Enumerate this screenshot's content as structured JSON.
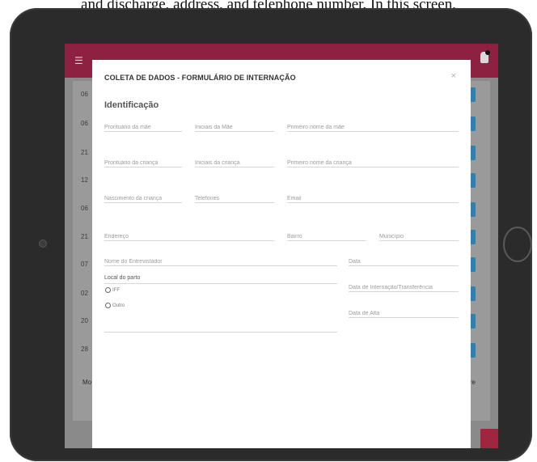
{
  "caption": {
    "text": "and discharge, address, and telephone number. In this screen,"
  },
  "app": {
    "bg_rows": [
      "06",
      "06",
      "21",
      "12",
      "06",
      "21",
      "07",
      "02",
      "20",
      "28"
    ],
    "bg_more_left": "Mo",
    "bg_more_right": "ire"
  },
  "modal": {
    "title": "COLETA DE DADOS - FORMULÁRIO DE INTERNAÇÃO",
    "section": "Identificação",
    "fields": {
      "prontuario_mae": "Prontuário da mãe",
      "iniciais_mae": "Iniciais da Mãe",
      "primeiro_nome_mae": "Primeiro nome da mãe",
      "prontuario_crianca": "Prontuário da criança",
      "iniciais_crianca": "Iniciais da criança",
      "primeiro_nome_crianca": "Primeiro nome da criança",
      "nascimento_crianca": "Nascimento da criança",
      "telefones": "Telefones",
      "email": "Email",
      "endereco": "Endereço",
      "bairro": "Bairro",
      "municipio": "Município",
      "entrevistador": "Nome do Entrevistador",
      "data": "Data",
      "data_internacao": "Data de Internação/Transferência",
      "data_alta": "Data de Alta"
    },
    "local_parto": {
      "label": "Local do parto",
      "options": [
        "IFF",
        "Outro"
      ]
    }
  }
}
